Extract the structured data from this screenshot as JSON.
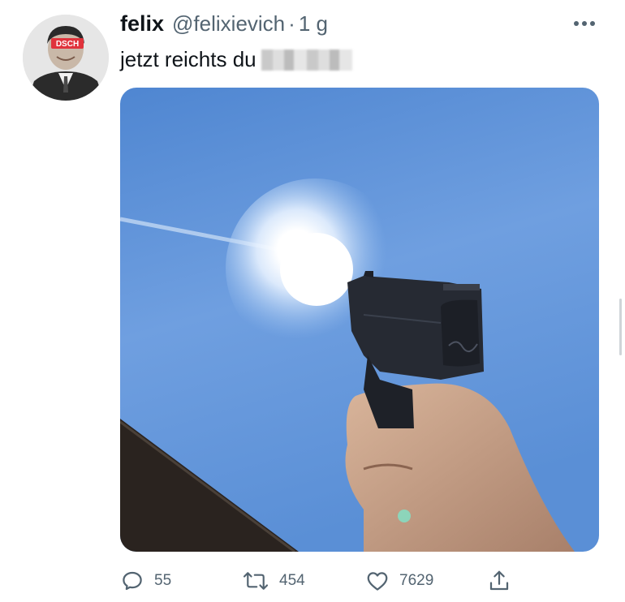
{
  "tweet": {
    "author_name": "felix",
    "handle": "@felixievich",
    "separator": "·",
    "time": "1 g",
    "text": "jetzt reichts du",
    "avatar_badge": "DSCH"
  },
  "actions": {
    "replies": "55",
    "retweets": "454",
    "likes": "7629"
  },
  "icons": [
    "more-icon",
    "reply-icon",
    "retweet-icon",
    "like-icon",
    "share-icon"
  ],
  "colors": {
    "secondary_text": "#536471",
    "sky": "#5f93d8"
  }
}
